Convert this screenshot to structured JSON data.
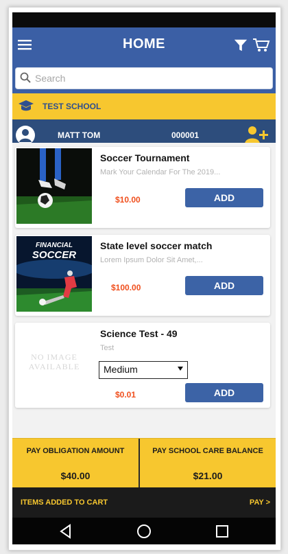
{
  "app": {
    "title": "HOME"
  },
  "search": {
    "placeholder": "Search"
  },
  "school": {
    "name": "TEST SCHOOL"
  },
  "user": {
    "name": "MATT TOM",
    "id": "000001"
  },
  "items": [
    {
      "name": "Soccer Tournament",
      "description": "Mark Your Calendar For The 2019...",
      "price": "$10.00",
      "add_label": "ADD"
    },
    {
      "name": "State level soccer match",
      "description": "Lorem Ipsum Dolor Sit Amet,...",
      "price": "$100.00",
      "add_label": "ADD",
      "image_text": [
        "FINANCIAL",
        "SOCCER"
      ]
    },
    {
      "name": "Science Test - 49",
      "description": "Test",
      "price": "$0.01",
      "add_label": "ADD",
      "select_value": "Medium",
      "no_image_text": [
        "NO IMAGE",
        "AVAILABLE"
      ]
    }
  ],
  "pay": {
    "obligation_label": "PAY OBLIGATION AMOUNT",
    "obligation_amount": "$40.00",
    "care_label": "PAY SCHOOL CARE BALANCE",
    "care_amount": "$21.00"
  },
  "cart": {
    "items_label": "ITEMS ADDED TO CART",
    "pay_label": "PAY >"
  },
  "colors": {
    "primary": "#3b5fa5",
    "accent": "#f7c72f",
    "price": "#f04f1d",
    "dark": "#2d4d7c"
  },
  "icons": [
    "menu-icon",
    "filter-icon",
    "cart-icon",
    "search-icon",
    "graduation-cap-icon",
    "avatar-icon",
    "add-user-icon",
    "back-icon",
    "home-icon",
    "recent-apps-icon"
  ]
}
